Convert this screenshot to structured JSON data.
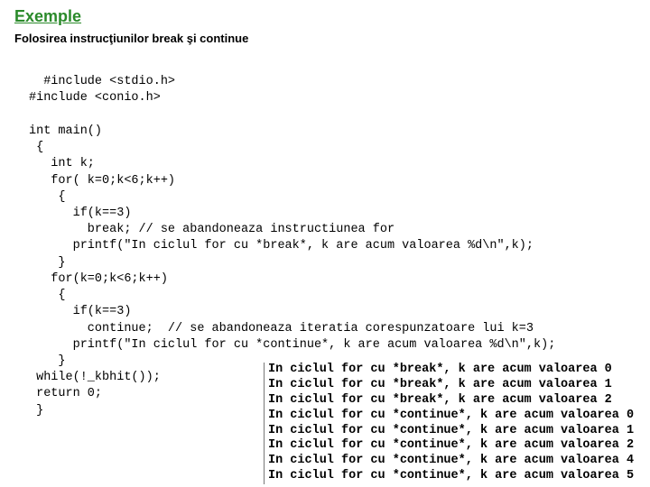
{
  "title": "Exemple",
  "subtitle": "Folosirea instrucţiunilor break şi continue",
  "code": "#include <stdio.h>\n#include <conio.h>\n\nint main()\n {\n   int k;\n   for( k=0;k<6;k++)\n    {\n      if(k==3)\n        break; // se abandoneaza instructiunea for\n      printf(\"In ciclul for cu *break*, k are acum valoarea %d\\n\",k);\n    }\n   for(k=0;k<6;k++)\n    {\n      if(k==3)\n        continue;  // se abandoneaza iteratia corespunzatoare lui k=3\n      printf(\"In ciclul for cu *continue*, k are acum valoarea %d\\n\",k);\n    }\n while(!_kbhit());\n return 0;\n }",
  "output": "In ciclul for cu *break*, k are acum valoarea 0\nIn ciclul for cu *break*, k are acum valoarea 1\nIn ciclul for cu *break*, k are acum valoarea 2\nIn ciclul for cu *continue*, k are acum valoarea 0\nIn ciclul for cu *continue*, k are acum valoarea 1\nIn ciclul for cu *continue*, k are acum valoarea 2\nIn ciclul for cu *continue*, k are acum valoarea 4\nIn ciclul for cu *continue*, k are acum valoarea 5"
}
